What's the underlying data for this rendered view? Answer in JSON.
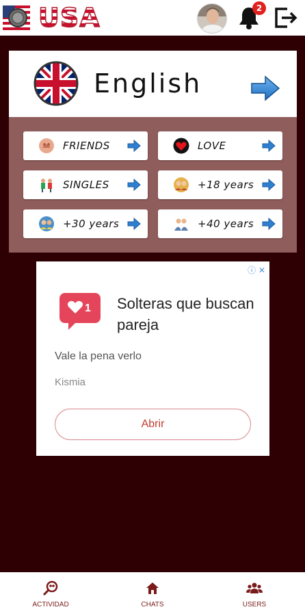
{
  "header": {
    "country": "USA",
    "notifications_count": "2"
  },
  "language": {
    "label": "English"
  },
  "categories": [
    {
      "label": "FRIENDS"
    },
    {
      "label": "LOVE"
    },
    {
      "label": "SINGLES"
    },
    {
      "label": "+18 years"
    },
    {
      "label": "+30 years"
    },
    {
      "label": "+40 years"
    }
  ],
  "ad": {
    "title": "Solteras que buscan pareja",
    "subtitle": "Vale la pena verlo",
    "advertiser": "Kismia",
    "cta": "Abrir",
    "badge_count": "1"
  },
  "bottom_nav": [
    {
      "label": "ACTIVIDAD",
      "icon": "activity-search-icon"
    },
    {
      "label": "CHATS",
      "icon": "home-icon"
    },
    {
      "label": "USERS",
      "icon": "users-icon"
    }
  ],
  "colors": {
    "background": "#2e0004",
    "panel": "#8f5d5b",
    "accent": "#7a1a1a",
    "ad_cta": "#c0392b"
  }
}
